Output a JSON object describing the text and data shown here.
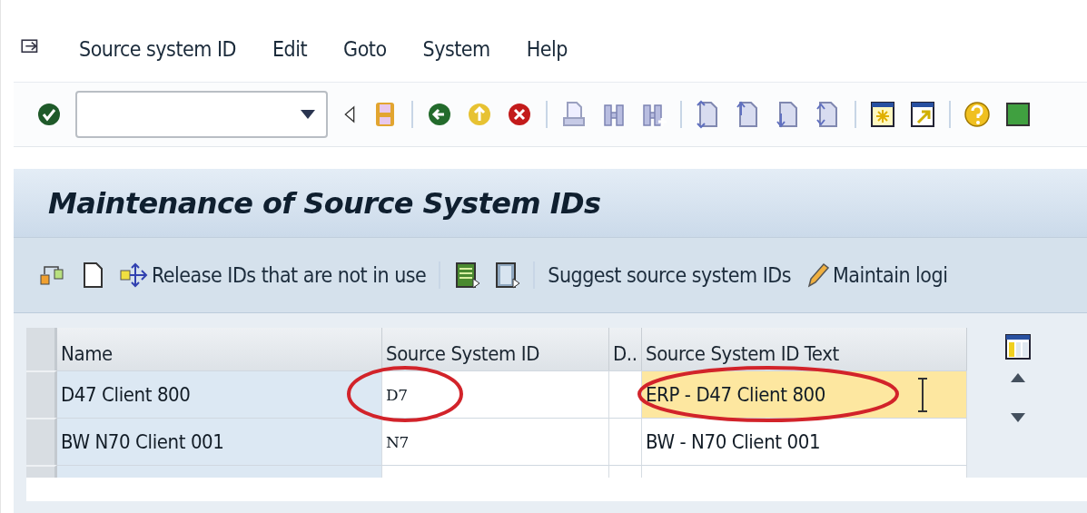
{
  "menu": [
    {
      "label": "Source system ID"
    },
    {
      "label": "Edit"
    },
    {
      "label": "Goto"
    },
    {
      "label": "System"
    },
    {
      "label": "Help"
    }
  ],
  "title": "Maintenance of Source System IDs",
  "app_toolbar": {
    "release_button": "Release IDs that are not in use",
    "suggest_button": "Suggest source system IDs",
    "maintain_button": "Maintain logi"
  },
  "table": {
    "columns": [
      "Name",
      "Source System ID",
      "D..",
      "Source System ID Text"
    ],
    "rows": [
      {
        "name": "D47 Client 800",
        "source_system_id": "D7",
        "source_system_id_text": "ERP - D47 Client 800",
        "focused": true,
        "circled": true
      },
      {
        "name": "BW N70 Client 001",
        "source_system_id": "N7",
        "source_system_id_text": "BW - N70 Client 001",
        "focused": false,
        "circled": false
      }
    ]
  }
}
